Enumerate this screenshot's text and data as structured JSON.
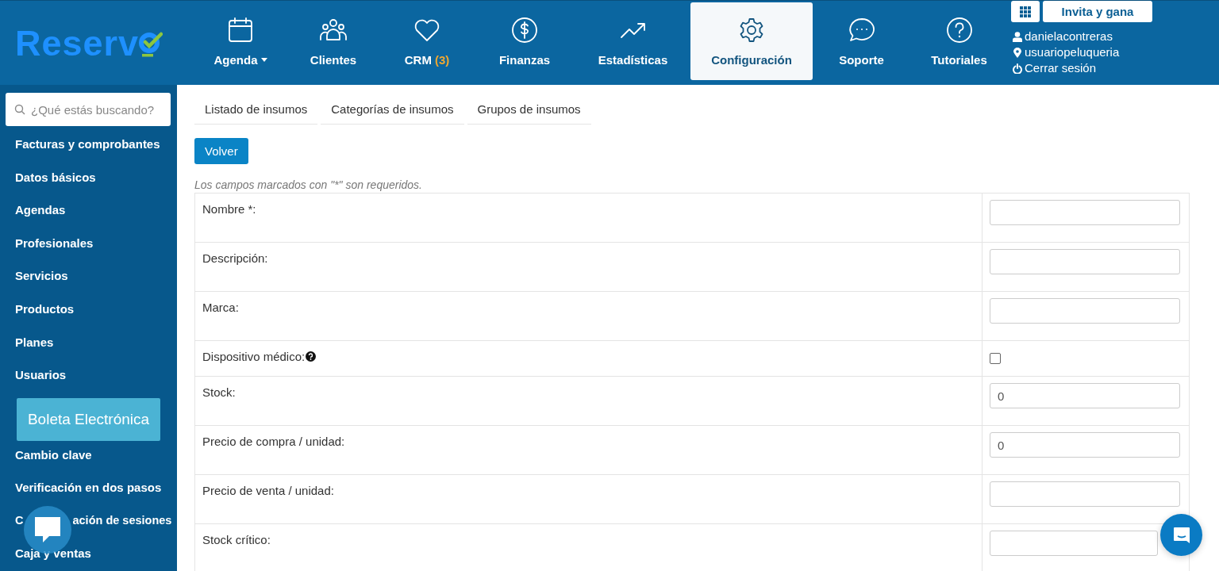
{
  "logo": {
    "text": "Reserv"
  },
  "nav": [
    {
      "label": "Agenda",
      "dropdown": true,
      "selected": false
    },
    {
      "label": "Clientes",
      "selected": false
    },
    {
      "label": "CRM",
      "count": "(3)",
      "selected": false
    },
    {
      "label": "Finanzas",
      "selected": false
    },
    {
      "label": "Estadísticas",
      "selected": false
    },
    {
      "label": "Configuración",
      "selected": true
    },
    {
      "label": "Soporte",
      "selected": false
    },
    {
      "label": "Tutoriales",
      "selected": false
    }
  ],
  "user": {
    "invite": "Invita y gana",
    "username": "danielacontreras",
    "account": "usuariopeluqueria",
    "logout": "Cerrar sesión"
  },
  "sidebar": {
    "search_placeholder": "¿Qué estás buscando?",
    "items": [
      {
        "kind": "link",
        "label": "Facturas y comprobantes"
      },
      {
        "kind": "link",
        "label": "Datos básicos"
      },
      {
        "kind": "link",
        "label": "Agendas"
      },
      {
        "kind": "link",
        "label": "Profesionales"
      },
      {
        "kind": "link",
        "label": "Servicios"
      },
      {
        "kind": "link",
        "label": "Productos"
      },
      {
        "kind": "link",
        "label": "Planes"
      },
      {
        "kind": "link",
        "label": "Usuarios"
      },
      {
        "kind": "promo",
        "label": "Boleta Electrónica"
      },
      {
        "kind": "link",
        "label": "Cambio clave"
      },
      {
        "kind": "link",
        "label": "Verificación en dos pasos"
      },
      {
        "kind": "covered",
        "visible_parts": [
          "C",
          "ación de sesiones"
        ]
      },
      {
        "kind": "link",
        "label": "Caja y ventas"
      }
    ]
  },
  "subtabs": [
    {
      "label": "Listado de insumos"
    },
    {
      "label": "Categorías de insumos"
    },
    {
      "label": "Grupos de insumos"
    }
  ],
  "back_button": "Volver",
  "required_note": "Los campos marcados con \"*\" son requeridos.",
  "form": [
    {
      "kind": "text",
      "label": "Nombre *:"
    },
    {
      "kind": "text",
      "label": "Descripción:"
    },
    {
      "kind": "text",
      "label": "Marca:"
    },
    {
      "kind": "checkbox",
      "label": "Dispositivo médico:",
      "help": true,
      "checked": false
    },
    {
      "kind": "text",
      "label": "Stock:",
      "value": "0"
    },
    {
      "kind": "text",
      "label": "Precio de compra / unidad:",
      "value": "0"
    },
    {
      "kind": "text",
      "label": "Precio de venta / unidad:"
    },
    {
      "kind": "text",
      "label": "Stock crítico:"
    }
  ]
}
